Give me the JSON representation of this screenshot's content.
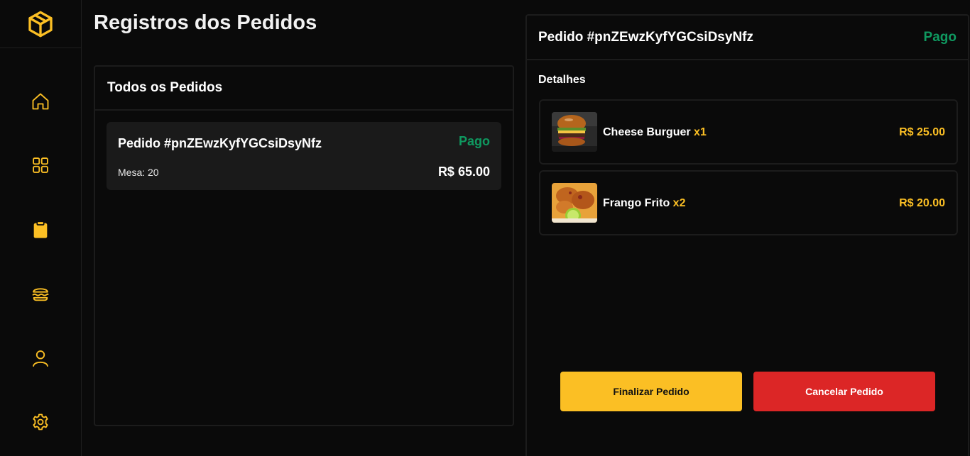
{
  "app": {
    "logo_icon": "box-icon",
    "accent_color": "#fbbf24",
    "paid_color": "#0f9960",
    "danger_color": "#dc2626"
  },
  "sidebar": {
    "items": [
      {
        "icon": "home-icon",
        "active": false
      },
      {
        "icon": "grid-icon",
        "active": false
      },
      {
        "icon": "clipboard-icon",
        "active": true
      },
      {
        "icon": "burger-icon",
        "active": false
      },
      {
        "icon": "user-icon",
        "active": false
      },
      {
        "icon": "gear-icon",
        "active": false
      }
    ]
  },
  "page": {
    "title": "Registros dos Pedidos"
  },
  "orders": {
    "panel_title": "Todos os Pedidos",
    "list": [
      {
        "title": "Pedido #pnZEwzKyfYGCsiDsyNfz",
        "status": "Pago",
        "table": "Mesa: 20",
        "total": "R$ 65.00"
      }
    ]
  },
  "detail": {
    "title": "Pedido #pnZEwzKyfYGCsiDsyNfz",
    "status": "Pago",
    "section_label": "Detalhes",
    "items": [
      {
        "name": "Cheese Burguer",
        "qty": "x1",
        "price": "R$ 25.00",
        "image": "burger-photo"
      },
      {
        "name": "Frango Frito",
        "qty": "x2",
        "price": "R$ 20.00",
        "image": "fried-chicken-photo"
      }
    ],
    "finish_label": "Finalizar Pedido",
    "cancel_label": "Cancelar Pedido"
  }
}
